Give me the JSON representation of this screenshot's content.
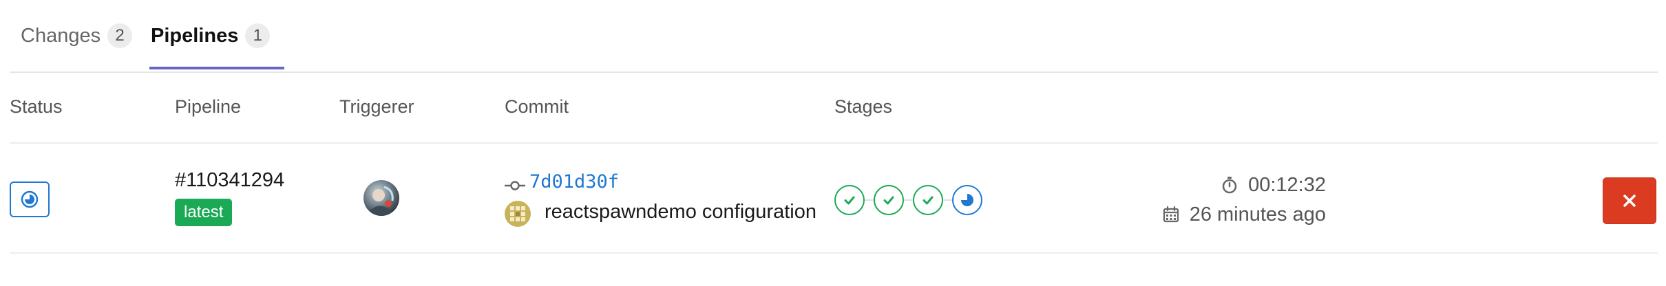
{
  "tabs": [
    {
      "label": "Changes",
      "count": "2"
    },
    {
      "label": "Pipelines",
      "count": "1"
    }
  ],
  "table": {
    "headers": {
      "status": "Status",
      "pipeline": "Pipeline",
      "triggerer": "Triggerer",
      "commit": "Commit",
      "stages": "Stages"
    }
  },
  "pipeline_row": {
    "status": "running",
    "id": "#110341294",
    "badge": "latest",
    "triggerer_icon": "user-avatar",
    "commit": {
      "sha": "7d01d30f",
      "title": "reactspawndemo configuration",
      "project_icon": "project-identicon"
    },
    "stages": [
      {
        "status": "success",
        "icon": "check-icon"
      },
      {
        "status": "success",
        "icon": "check-icon"
      },
      {
        "status": "success",
        "icon": "check-icon"
      },
      {
        "status": "running",
        "icon": "running-icon"
      }
    ],
    "duration": "00:12:32",
    "finished": "26 minutes ago",
    "cancel_icon": "close-icon"
  },
  "colors": {
    "accent_tab": "#6666c4",
    "running": "#1f78d1",
    "success": "#1aaa55",
    "danger": "#db3b21"
  }
}
